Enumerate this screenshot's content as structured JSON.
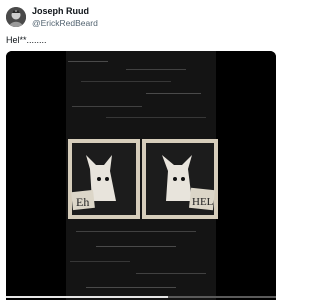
{
  "author": {
    "display_name": "Joseph Ruud",
    "handle": "@ErickRedBeard",
    "avatar_icon": "avatar-photo"
  },
  "tweet": {
    "text": "Hel**........"
  },
  "media": {
    "type": "video",
    "left_sign_text": "Eh",
    "right_sign_text": "HEL",
    "progress": 0.6
  },
  "colors": {
    "video_background": "#000000",
    "film_grain": "#1e1e1e",
    "sepia_frame": "#d6cdbb",
    "handle_gray": "#536471"
  }
}
